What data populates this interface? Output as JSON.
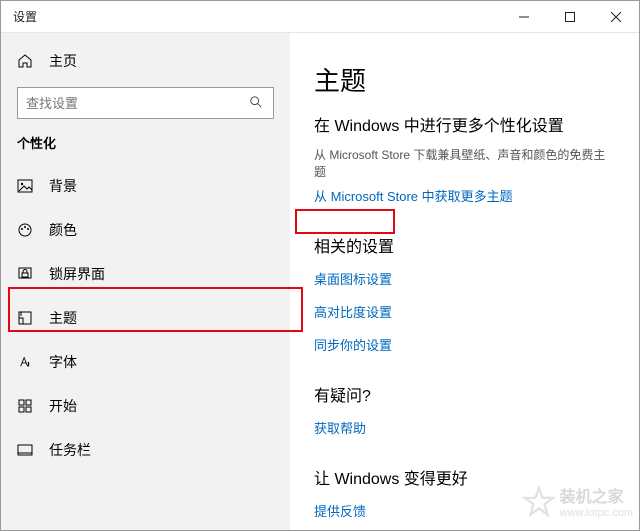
{
  "window": {
    "title": "设置"
  },
  "sidebar": {
    "home": "主页",
    "search_placeholder": "查找设置",
    "category": "个性化",
    "items": [
      {
        "label": "背景"
      },
      {
        "label": "颜色"
      },
      {
        "label": "锁屏界面"
      },
      {
        "label": "主题"
      },
      {
        "label": "字体"
      },
      {
        "label": "开始"
      },
      {
        "label": "任务栏"
      }
    ]
  },
  "main": {
    "title": "主题",
    "subtitle": "在 Windows 中进行更多个性化设置",
    "description": "从 Microsoft Store 下载兼具壁纸、声音和颜色的免费主题",
    "store_link": "从 Microsoft Store 中获取更多主题",
    "related": {
      "title": "相关的设置",
      "links": [
        "桌面图标设置",
        "高对比度设置",
        "同步你的设置"
      ]
    },
    "help": {
      "title": "有疑问?",
      "link": "获取帮助"
    },
    "feedback": {
      "title": "让 Windows 变得更好",
      "link": "提供反馈"
    }
  },
  "watermark": {
    "name": "装机之家",
    "url": "www.lotpc.com"
  }
}
